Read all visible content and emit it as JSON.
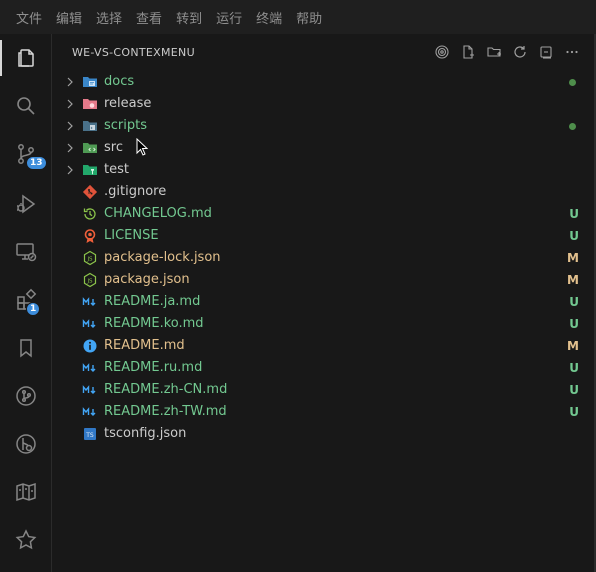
{
  "menu": [
    "文件",
    "编辑",
    "选择",
    "查看",
    "转到",
    "运行",
    "终端",
    "帮助"
  ],
  "activity": [
    {
      "icon": "files-icon",
      "active": true
    },
    {
      "icon": "search-icon"
    },
    {
      "icon": "source-control-icon",
      "badge": "13"
    },
    {
      "icon": "run-debug-icon"
    },
    {
      "icon": "remote-explorer-icon"
    },
    {
      "icon": "extensions-icon",
      "badge": "1"
    },
    {
      "icon": "bookmark-icon"
    },
    {
      "icon": "git-graph-icon"
    },
    {
      "icon": "gitlens-icon"
    },
    {
      "icon": "book-map-icon"
    },
    {
      "icon": "star-icon"
    }
  ],
  "explorer": {
    "title": "WE-VS-CONTEXMENU",
    "tools": [
      "target-icon",
      "new-file-icon",
      "new-folder-icon",
      "refresh-icon",
      "collapse-all-icon",
      "more-icon"
    ],
    "items": [
      {
        "name": "docs",
        "type": "folder",
        "icon": "folder-docs-icon",
        "color": "green",
        "dot": true
      },
      {
        "name": "release",
        "type": "folder",
        "icon": "folder-release-icon",
        "color": "plain"
      },
      {
        "name": "scripts",
        "type": "folder",
        "icon": "folder-scripts-icon",
        "color": "green",
        "dot": true
      },
      {
        "name": "src",
        "type": "folder",
        "icon": "folder-src-icon",
        "color": "plain"
      },
      {
        "name": "test",
        "type": "folder",
        "icon": "folder-test-icon",
        "color": "plain"
      },
      {
        "name": ".gitignore",
        "type": "file",
        "icon": "git-icon",
        "color": "plain"
      },
      {
        "name": "CHANGELOG.md",
        "type": "file",
        "icon": "changelog-icon",
        "color": "green",
        "status": "U"
      },
      {
        "name": "LICENSE",
        "type": "file",
        "icon": "license-icon",
        "color": "green",
        "status": "U"
      },
      {
        "name": "package-lock.json",
        "type": "file",
        "icon": "nodejs-icon",
        "color": "mod",
        "status": "M"
      },
      {
        "name": "package.json",
        "type": "file",
        "icon": "nodejs-icon",
        "color": "mod",
        "status": "M"
      },
      {
        "name": "README.ja.md",
        "type": "file",
        "icon": "markdown-icon",
        "color": "green",
        "status": "U"
      },
      {
        "name": "README.ko.md",
        "type": "file",
        "icon": "markdown-icon",
        "color": "green",
        "status": "U"
      },
      {
        "name": "README.md",
        "type": "file",
        "icon": "info-icon",
        "color": "mod",
        "status": "M"
      },
      {
        "name": "README.ru.md",
        "type": "file",
        "icon": "markdown-icon",
        "color": "green",
        "status": "U"
      },
      {
        "name": "README.zh-CN.md",
        "type": "file",
        "icon": "markdown-icon",
        "color": "green",
        "status": "U"
      },
      {
        "name": "README.zh-TW.md",
        "type": "file",
        "icon": "markdown-icon",
        "color": "green",
        "status": "U"
      },
      {
        "name": "tsconfig.json",
        "type": "file",
        "icon": "tsconfig-icon",
        "color": "plain"
      }
    ]
  },
  "colors": {
    "untracked": "#73c991",
    "modified": "#e2c08d",
    "accent_badge": "#3d8ddb"
  }
}
